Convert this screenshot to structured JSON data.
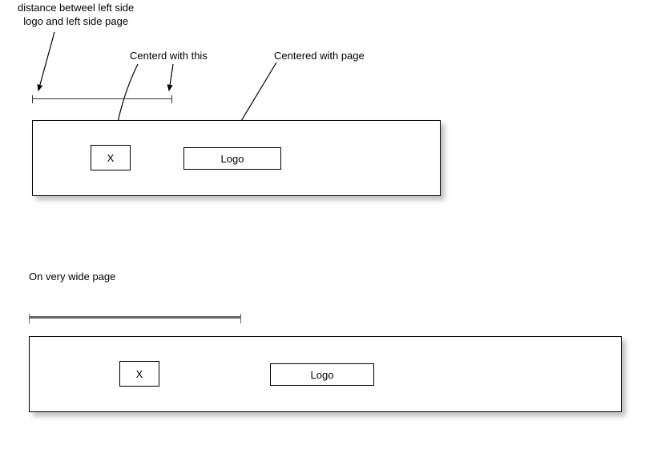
{
  "annotations": {
    "distanceLabel": "distance betweel left side\nlogo and left side page",
    "centeredX": "Centerd with this",
    "centeredLogo": "Centered  with page",
    "widePage": "On very wide  page"
  },
  "boxes": {
    "xLabel": "X",
    "logoLabel": "Logo"
  }
}
